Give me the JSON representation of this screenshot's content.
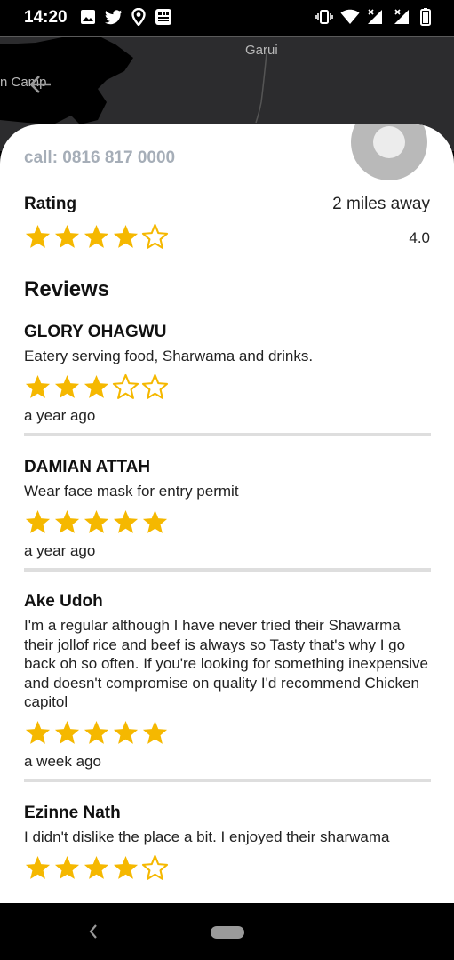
{
  "status_bar": {
    "time": "14:20",
    "left_icons": [
      "gallery-icon",
      "twitter-icon",
      "location-pin-icon",
      "app-grid-icon"
    ],
    "right_icons": [
      "vibrate-icon",
      "wifi-icon",
      "signal-x-icon",
      "signal-x-icon",
      "battery-icon"
    ]
  },
  "map": {
    "labels": {
      "top": "Garui",
      "left": "n Camp"
    },
    "back_icon": "arrow-back-icon"
  },
  "sheet": {
    "call": "call: 0816 817 0000",
    "rating_label": "Rating",
    "distance": "2 miles away",
    "rating_value": "4.0",
    "rating_stars": 4,
    "reviews_heading": "Reviews"
  },
  "reviews": [
    {
      "name": "GLORY OHAGWU",
      "text": "Eatery serving food, Sharwama and drinks.",
      "stars": 3,
      "time": "a year ago"
    },
    {
      "name": "DAMIAN ATTAH",
      "text": "Wear face mask for entry permit",
      "stars": 5,
      "time": "a year ago"
    },
    {
      "name": "Ake Udoh",
      "text": "I'm a regular although I have never tried their Shawarma their jollof rice and beef is always so Tasty that's why I go back oh so often. If you're looking for something inexpensive and doesn't compromise on quality I'd recommend Chicken capitol",
      "stars": 5,
      "time": "a week ago"
    },
    {
      "name": "Ezinne Nath",
      "text": "I didn't dislike the place a bit. I enjoyed their sharwama",
      "stars": 4,
      "time": ""
    }
  ],
  "colors": {
    "star": "#f5b800",
    "call_text": "#a6aeb8",
    "divider": "#dedede"
  },
  "nav_bar": {
    "back_icon": "nav-back-icon",
    "home_icon": "nav-home-pill"
  }
}
